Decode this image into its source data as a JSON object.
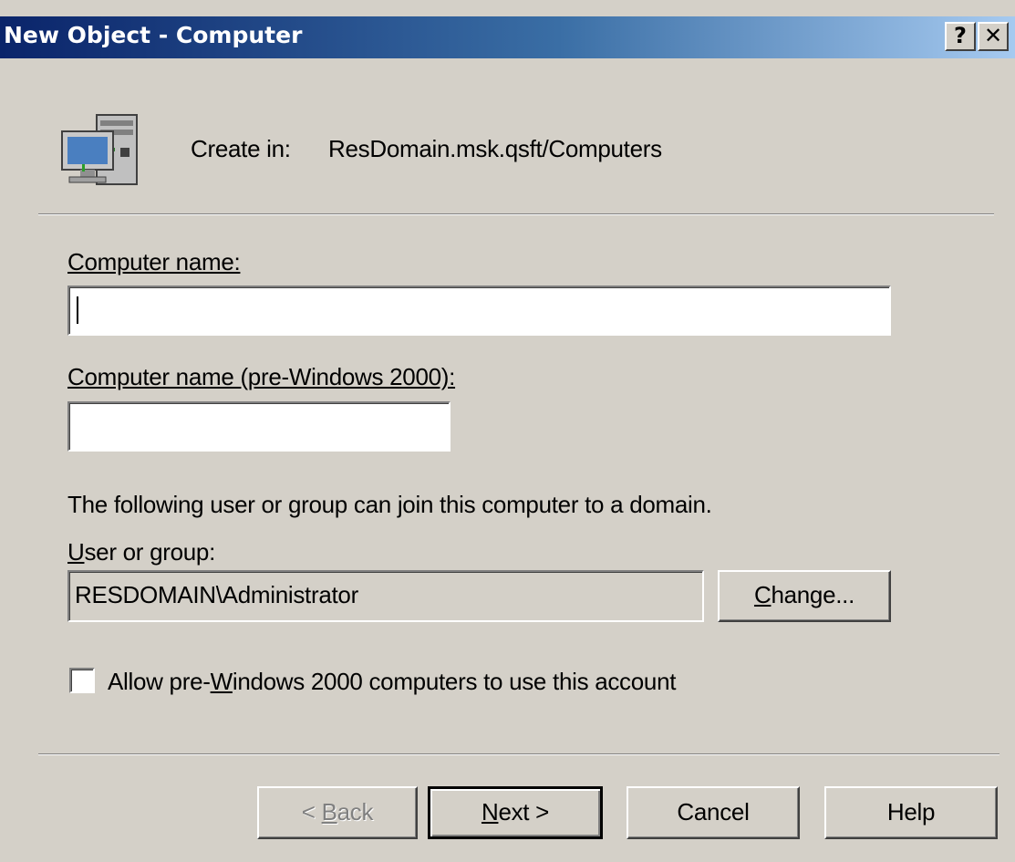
{
  "window": {
    "title": "New Object - Computer",
    "help_label": "?",
    "close_label": "✕"
  },
  "header": {
    "create_in_label": "Create in:",
    "create_in_path": "ResDomain.msk.qsft/Computers"
  },
  "form": {
    "computer_name_label": "Computer name:",
    "computer_name_value": "",
    "pre2000_label": "Computer name (pre-Windows 2000):",
    "pre2000_value": "",
    "join_info": "The following user or group can join this computer to a domain.",
    "user_group_label": "User or group:",
    "user_group_value": "RESDOMAIN\\Administrator",
    "change_button": "Change...",
    "allow_pre2000_label": "Allow pre-Windows 2000 computers to use this account",
    "allow_pre2000_checked": false
  },
  "buttons": {
    "back": "< Back",
    "next": "Next >",
    "cancel": "Cancel",
    "help": "Help"
  }
}
